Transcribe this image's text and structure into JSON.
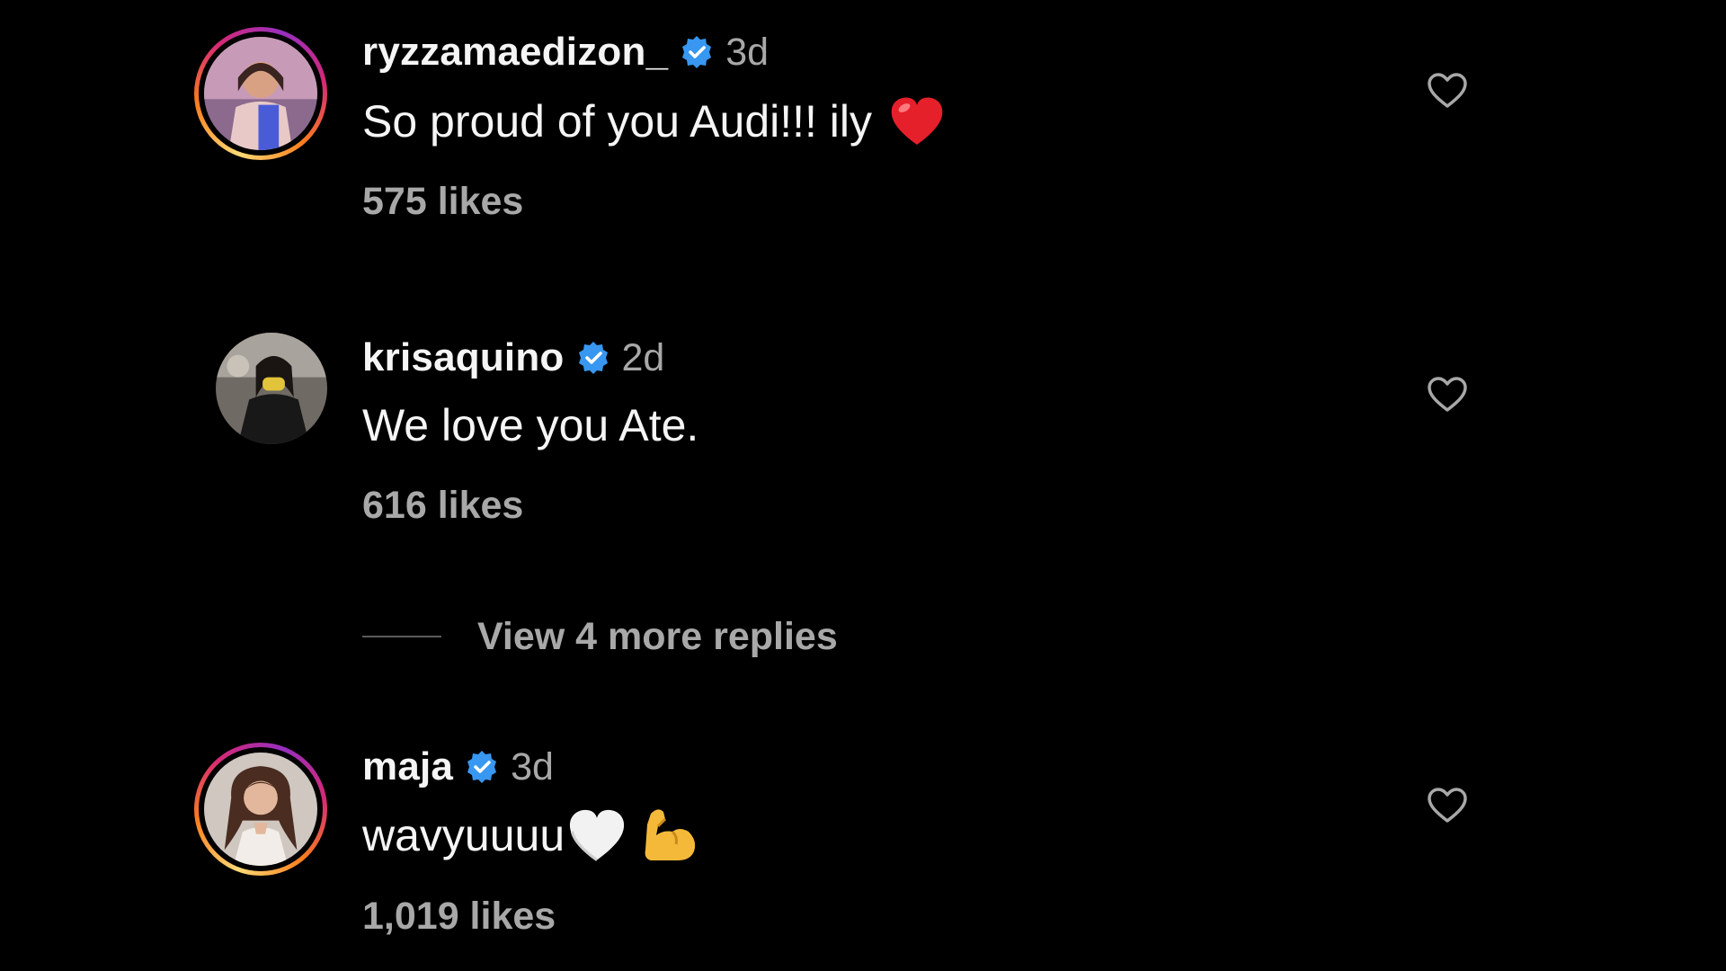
{
  "colors": {
    "background": "#000000",
    "primary_text": "#f5f5f5",
    "secondary_text": "#a8a8a8",
    "verified_blue": "#3897f0",
    "story_ring": [
      "#feda75",
      "#fa7e1e",
      "#d62976",
      "#962fbf"
    ]
  },
  "comments": [
    {
      "username": "ryzzamaedizon_",
      "verified": true,
      "time": "3d",
      "text": "So proud of you Audi!!! ily",
      "emoji": "red-heart-emoji",
      "likes": "575 likes",
      "has_story_ring": true,
      "avatar_icon": "user-avatar"
    },
    {
      "username": "krisaquino",
      "verified": true,
      "time": "2d",
      "text": "We love you Ate.",
      "likes": "616 likes",
      "has_story_ring": false,
      "avatar_icon": "user-avatar"
    },
    {
      "username": "maja",
      "verified": true,
      "time": "3d",
      "text": "wavyuuuu",
      "emoji": "white-heart-and-flexed-biceps-emoji",
      "likes": "1,019 likes",
      "has_story_ring": true,
      "avatar_icon": "user-avatar"
    }
  ],
  "view_replies": {
    "label": "View 4 more replies"
  }
}
